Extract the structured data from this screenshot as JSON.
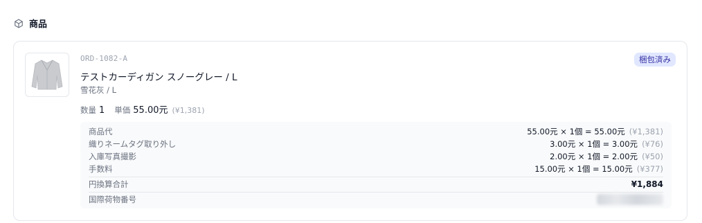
{
  "section": {
    "title": "商品",
    "icon": "package-icon"
  },
  "item": {
    "order_id": "ORD-1082-A",
    "status": "梱包済み",
    "product_name": "テストカーディガン スノーグレー / L",
    "variant": "雪花灰 / L",
    "quantity_label": "数量",
    "quantity": "1",
    "unit_price_label": "単価",
    "unit_price": "55.00元",
    "unit_price_jpy": "(¥1,381)",
    "thumbnail": "cardigan-image"
  },
  "breakdown": {
    "rows": [
      {
        "label": "商品代",
        "formula": "55.00元 × 1個 = 55.00元",
        "jpy": "(¥1,381)"
      },
      {
        "label": "織りネームタグ取り外し",
        "formula": "3.00元 × 1個 = 3.00元",
        "jpy": "(¥76)"
      },
      {
        "label": "入庫写真撮影",
        "formula": "2.00元 × 1個 = 2.00元",
        "jpy": "(¥50)"
      },
      {
        "label": "手数料",
        "formula": "15.00元 × 1個 = 15.00元",
        "jpy": "(¥377)"
      }
    ],
    "total_label": "円換算合計",
    "total_value": "¥1,884",
    "tracking_label": "国際荷物番号"
  },
  "colors": {
    "badge_bg": "#e0e7ff",
    "badge_text": "#3730a3",
    "muted": "#6b7280"
  }
}
